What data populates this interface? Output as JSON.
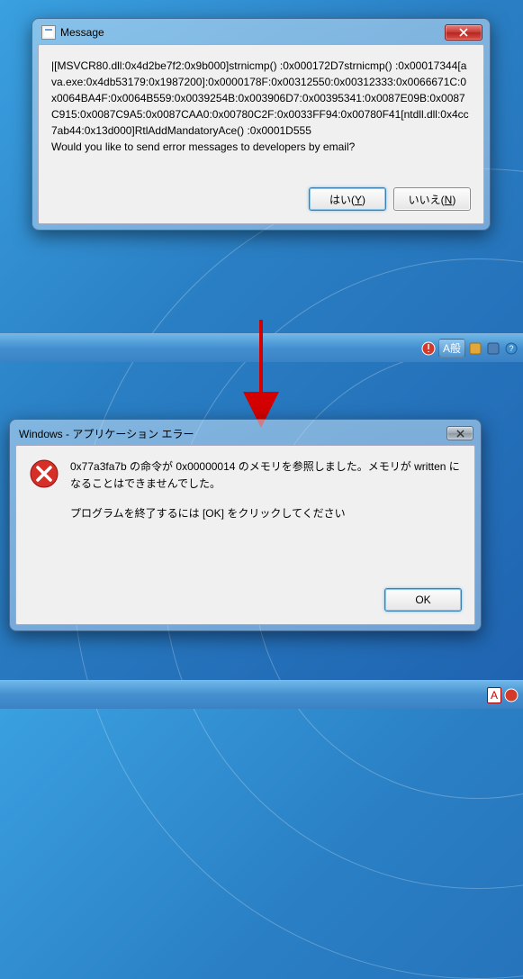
{
  "dialog1": {
    "title": "Message",
    "body": "|[MSVCR80.dll:0x4d2be7f2:0x9b000]strnicmp() :0x000172D7strnicmp() :0x00017344[ava.exe:0x4db53179:0x1987200]:0x0000178F:0x00312550:0x00312333:0x0066671C:0x0064BA4F:0x0064B559:0x0039254B:0x003906D7:0x00395341:0x0087E09B:0x0087C915:0x0087C9A5:0x0087CAA0:0x00780C2F:0x0033FF94:0x00780F41[ntdll.dll:0x4cc7ab44:0x13d000]RtlAddMandatoryAce() :0x0001D555\nWould you like to send error messages to developers by email?",
    "yes": "はい(Y)",
    "no": "いいえ(N)"
  },
  "dialog2": {
    "title": "Windows - アプリケーション エラー",
    "line1": "0x77a3fa7b の命令が 0x00000014 のメモリを参照しました。メモリが written になることはできませんでした。",
    "line2": "プログラムを終了するには [OK] をクリックしてください",
    "ok": "OK"
  },
  "tray": {
    "ime": "A般",
    "a_badge": "A"
  }
}
